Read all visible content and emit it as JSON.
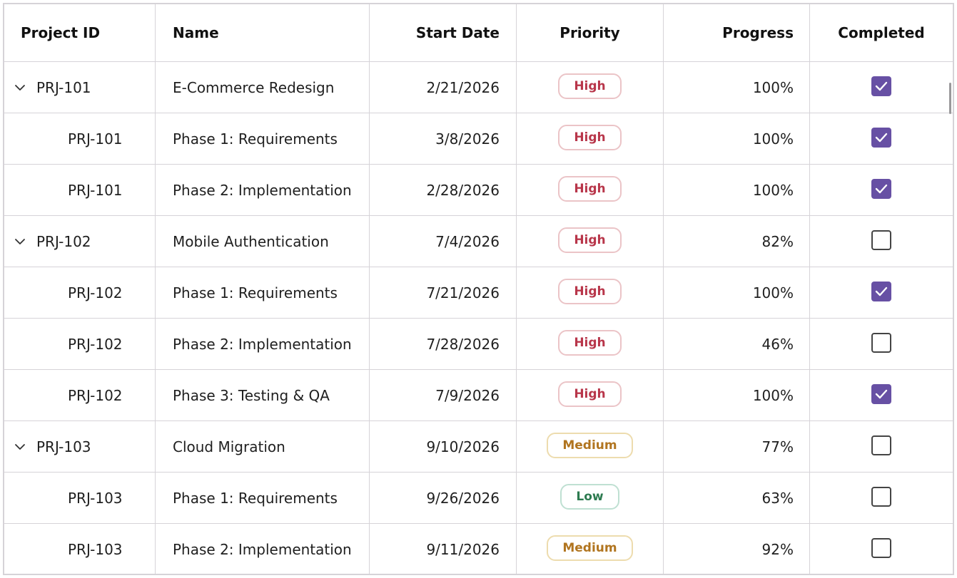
{
  "columns": {
    "project_id": "Project ID",
    "name": "Name",
    "start_date": "Start Date",
    "priority": "Priority",
    "progress": "Progress",
    "completed": "Completed"
  },
  "rows": [
    {
      "project_id": "PRJ-101",
      "name": "E-Commerce Redesign",
      "start_date": "2/21/2026",
      "priority": "High",
      "progress": "100%",
      "completed": true,
      "group": true
    },
    {
      "project_id": "PRJ-101",
      "name": "Phase 1: Requirements",
      "start_date": "3/8/2026",
      "priority": "High",
      "progress": "100%",
      "completed": true,
      "group": false
    },
    {
      "project_id": "PRJ-101",
      "name": "Phase 2: Implementation",
      "start_date": "2/28/2026",
      "priority": "High",
      "progress": "100%",
      "completed": true,
      "group": false
    },
    {
      "project_id": "PRJ-102",
      "name": "Mobile Authentication",
      "start_date": "7/4/2026",
      "priority": "High",
      "progress": "82%",
      "completed": false,
      "group": true
    },
    {
      "project_id": "PRJ-102",
      "name": "Phase 1: Requirements",
      "start_date": "7/21/2026",
      "priority": "High",
      "progress": "100%",
      "completed": true,
      "group": false
    },
    {
      "project_id": "PRJ-102",
      "name": "Phase 2: Implementation",
      "start_date": "7/28/2026",
      "priority": "High",
      "progress": "46%",
      "completed": false,
      "group": false
    },
    {
      "project_id": "PRJ-102",
      "name": "Phase 3: Testing & QA",
      "start_date": "7/9/2026",
      "priority": "High",
      "progress": "100%",
      "completed": true,
      "group": false
    },
    {
      "project_id": "PRJ-103",
      "name": "Cloud Migration",
      "start_date": "9/10/2026",
      "priority": "Medium",
      "progress": "77%",
      "completed": false,
      "group": true
    },
    {
      "project_id": "PRJ-103",
      "name": "Phase 1: Requirements",
      "start_date": "9/26/2026",
      "priority": "Low",
      "progress": "63%",
      "completed": false,
      "group": false
    },
    {
      "project_id": "PRJ-103",
      "name": "Phase 2: Implementation",
      "start_date": "9/11/2026",
      "priority": "Medium",
      "progress": "92%",
      "completed": false,
      "group": false
    }
  ],
  "icons": {
    "expand": "chevron-down-icon",
    "checked": "checkmark-icon"
  },
  "colors": {
    "accent": "#6750a4",
    "high": "#b8364a",
    "medium": "#b17520",
    "low": "#2d7b50",
    "gridline": "#d6d3d8"
  }
}
